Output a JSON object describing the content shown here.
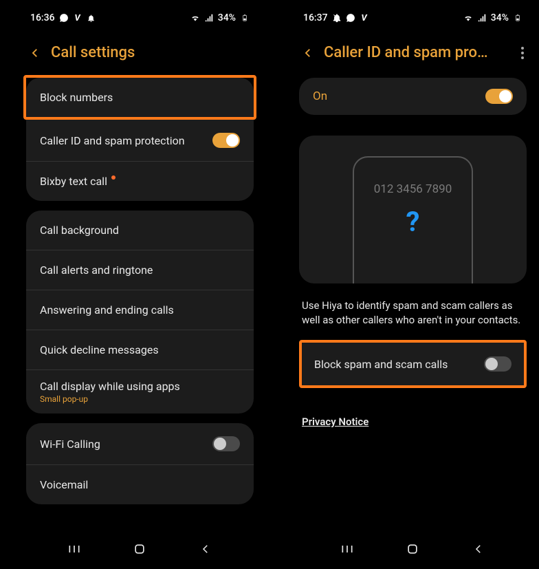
{
  "left": {
    "status": {
      "time": "16:36",
      "battery": "34%"
    },
    "title": "Call settings",
    "group1": {
      "block_numbers": "Block numbers",
      "caller_id": "Caller ID and spam protection",
      "bixby": "Bixby text call"
    },
    "group2": {
      "call_bg": "Call background",
      "alerts": "Call alerts and ringtone",
      "answering": "Answering and ending calls",
      "decline": "Quick decline messages",
      "display": "Call display while using apps",
      "display_sub": "Small pop-up"
    },
    "group3": {
      "wifi": "Wi-Fi Calling",
      "voicemail": "Voicemail"
    }
  },
  "right": {
    "status": {
      "time": "16:37",
      "battery": "34%"
    },
    "title": "Caller ID and spam pro…",
    "on_label": "On",
    "mock_number": "012 3456 7890",
    "description": "Use Hiya to identify spam and scam callers as well as other callers who aren't in your contacts.",
    "block_spam": "Block spam and scam calls",
    "privacy": "Privacy Notice"
  }
}
